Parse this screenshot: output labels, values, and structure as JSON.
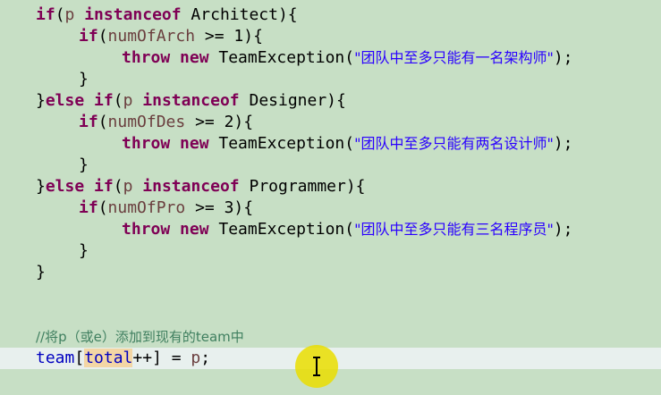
{
  "editor": {
    "lines": [
      {
        "indent": 1,
        "tokens": [
          {
            "t": "kw",
            "v": "if"
          },
          {
            "t": "plain",
            "v": "("
          },
          {
            "t": "var",
            "v": "p"
          },
          {
            "t": "plain",
            "v": " "
          },
          {
            "t": "kw",
            "v": "instanceof"
          },
          {
            "t": "plain",
            "v": " Architect){"
          }
        ]
      },
      {
        "indent": 2,
        "tokens": [
          {
            "t": "kw",
            "v": "if"
          },
          {
            "t": "plain",
            "v": "("
          },
          {
            "t": "var",
            "v": "numOfArch"
          },
          {
            "t": "plain",
            "v": " >= 1){"
          }
        ]
      },
      {
        "indent": 3,
        "tokens": [
          {
            "t": "kw",
            "v": "throw"
          },
          {
            "t": "plain",
            "v": " "
          },
          {
            "t": "kw",
            "v": "new"
          },
          {
            "t": "plain",
            "v": " TeamException("
          },
          {
            "t": "str",
            "v": "\"团队中至多只能有一名架构师\""
          },
          {
            "t": "plain",
            "v": ");"
          }
        ]
      },
      {
        "indent": 2,
        "tokens": [
          {
            "t": "plain",
            "v": "}"
          }
        ]
      },
      {
        "indent": 1,
        "tokens": [
          {
            "t": "plain",
            "v": "}"
          },
          {
            "t": "kw",
            "v": "else"
          },
          {
            "t": "plain",
            "v": " "
          },
          {
            "t": "kw",
            "v": "if"
          },
          {
            "t": "plain",
            "v": "("
          },
          {
            "t": "var",
            "v": "p"
          },
          {
            "t": "plain",
            "v": " "
          },
          {
            "t": "kw",
            "v": "instanceof"
          },
          {
            "t": "plain",
            "v": " Designer){"
          }
        ]
      },
      {
        "indent": 2,
        "tokens": [
          {
            "t": "kw",
            "v": "if"
          },
          {
            "t": "plain",
            "v": "("
          },
          {
            "t": "var",
            "v": "numOfDes"
          },
          {
            "t": "plain",
            "v": " >= 2){"
          }
        ]
      },
      {
        "indent": 3,
        "tokens": [
          {
            "t": "kw",
            "v": "throw"
          },
          {
            "t": "plain",
            "v": " "
          },
          {
            "t": "kw",
            "v": "new"
          },
          {
            "t": "plain",
            "v": " TeamException("
          },
          {
            "t": "str",
            "v": "\"团队中至多只能有两名设计师\""
          },
          {
            "t": "plain",
            "v": ");"
          }
        ]
      },
      {
        "indent": 2,
        "tokens": [
          {
            "t": "plain",
            "v": "}"
          }
        ]
      },
      {
        "indent": 1,
        "tokens": [
          {
            "t": "plain",
            "v": "}"
          },
          {
            "t": "kw",
            "v": "else"
          },
          {
            "t": "plain",
            "v": " "
          },
          {
            "t": "kw",
            "v": "if"
          },
          {
            "t": "plain",
            "v": "("
          },
          {
            "t": "var",
            "v": "p"
          },
          {
            "t": "plain",
            "v": " "
          },
          {
            "t": "kw",
            "v": "instanceof"
          },
          {
            "t": "plain",
            "v": " Programmer){"
          }
        ]
      },
      {
        "indent": 2,
        "tokens": [
          {
            "t": "kw",
            "v": "if"
          },
          {
            "t": "plain",
            "v": "("
          },
          {
            "t": "var",
            "v": "numOfPro"
          },
          {
            "t": "plain",
            "v": " >= 3){"
          }
        ]
      },
      {
        "indent": 3,
        "tokens": [
          {
            "t": "kw",
            "v": "throw"
          },
          {
            "t": "plain",
            "v": " "
          },
          {
            "t": "kw",
            "v": "new"
          },
          {
            "t": "plain",
            "v": " TeamException("
          },
          {
            "t": "str",
            "v": "\"团队中至多只能有三名程序员\""
          },
          {
            "t": "plain",
            "v": ");"
          }
        ]
      },
      {
        "indent": 2,
        "tokens": [
          {
            "t": "plain",
            "v": "}"
          }
        ]
      },
      {
        "indent": 1,
        "tokens": [
          {
            "t": "plain",
            "v": "}"
          }
        ]
      },
      {
        "indent": 1,
        "tokens": []
      },
      {
        "indent": 1,
        "tokens": []
      },
      {
        "indent": 1,
        "tokens": [
          {
            "t": "cmt",
            "v": "//将p（或e）添加到现有的team中"
          }
        ]
      },
      {
        "indent": 1,
        "current": true,
        "tokens": [
          {
            "t": "fld",
            "v": "team"
          },
          {
            "t": "plain",
            "v": "["
          },
          {
            "t": "fld hl",
            "v": "total"
          },
          {
            "t": "plain",
            "v": "++] = "
          },
          {
            "t": "var",
            "v": "p"
          },
          {
            "t": "plain",
            "v": ";"
          }
        ]
      }
    ]
  },
  "theme": {
    "background": "#c7dfc5",
    "keyword": "#7f0055",
    "local_variable": "#6a3e3e",
    "string": "#2a00ff",
    "comment": "#3f7f5f",
    "field": "#0000c0",
    "occurrence_highlight": "#f3d6a5",
    "current_line": "#e8f0ee",
    "cursor_highlight": "#eade00"
  },
  "pointer": {
    "icon": "text-cursor-ibeam-icon"
  }
}
